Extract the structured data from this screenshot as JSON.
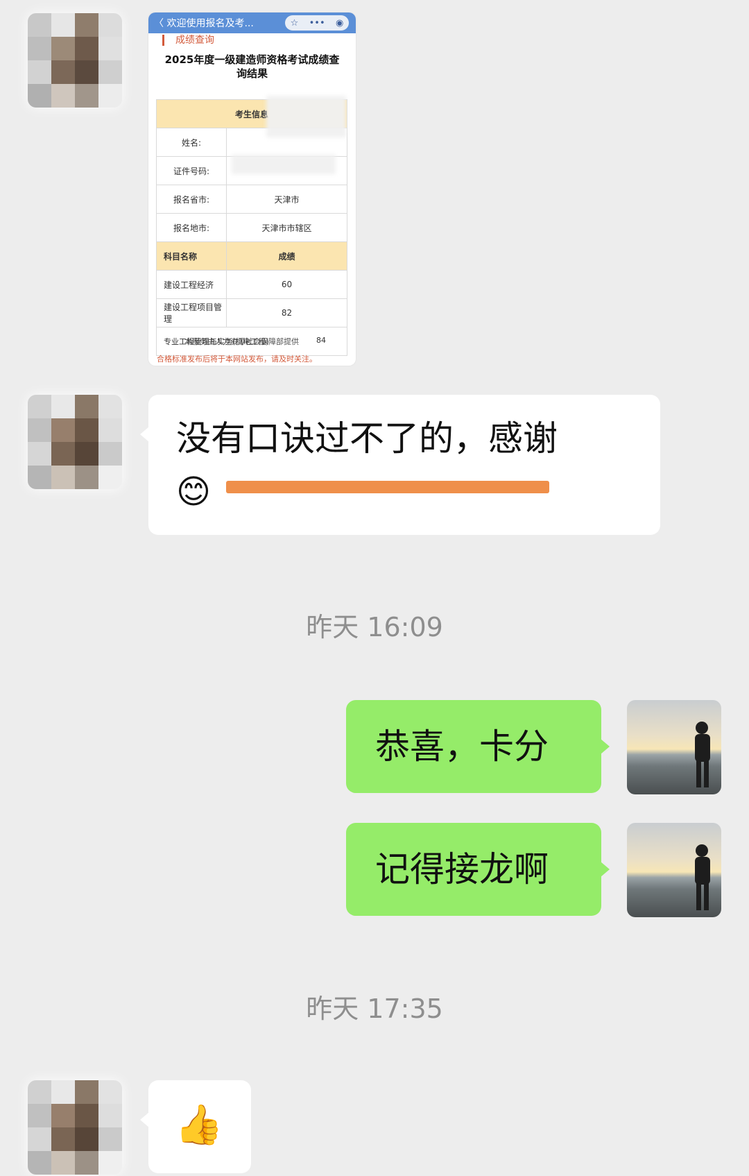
{
  "chat": {
    "screenshot": {
      "topbar_title": "〈 欢迎使用报名及考...",
      "capsule_icons": [
        "star-icon",
        "more-icon",
        "record-icon"
      ],
      "section_title": "成绩查询",
      "heading": "2025年度一级建造师资格考试成绩查询结果",
      "candidate_header": "考生信息",
      "rows": [
        {
          "label": "姓名:",
          "value": ""
        },
        {
          "label": "证件号码:",
          "value": ""
        },
        {
          "label": "报名省市:",
          "value": "天津市"
        },
        {
          "label": "报名地市:",
          "value": "天津市市辖区"
        }
      ],
      "subject_header": "科目名称",
      "score_header": "成绩",
      "subjects": [
        {
          "name": "建设工程经济",
          "score": "60"
        },
        {
          "name": "建设工程项目管理",
          "score": "82"
        },
        {
          "name": "专业工程管理与实务(机电工程)",
          "score": "84"
        }
      ],
      "overlap_text": "本服务由人力资源社会保障部提供",
      "footer": "合格标准发布后将于本网站发布，请及时关注。"
    },
    "message1": "没有口诀过不了的，感谢",
    "emoji_smile": "😊",
    "time1": "昨天 16:09",
    "message2": "恭喜，卡分",
    "message3": "记得接龙啊",
    "time2": "昨天 17:35",
    "emoji_thumb": "👍"
  }
}
